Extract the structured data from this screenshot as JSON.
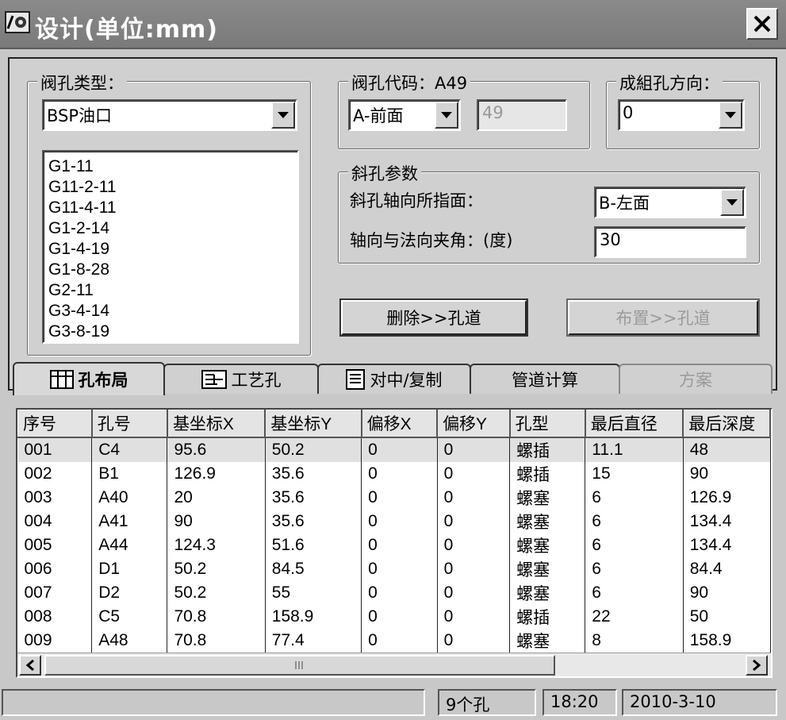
{
  "window": {
    "title": "设计(单位:mm)",
    "close_label": "X"
  },
  "hole_type": {
    "group_title": "阀孔类型：",
    "selected": "BSP油口",
    "list": [
      "G1-11",
      "G11-2-11",
      "G11-4-11",
      "G1-2-14",
      "G1-4-19",
      "G1-8-28",
      "G2-11",
      "G3-4-14",
      "G3-8-19"
    ]
  },
  "hole_code": {
    "group_title": "阀孔代码：A49",
    "face_selected": "A-前面",
    "code_value": "49"
  },
  "group_direction": {
    "group_title": "成組孔方向：",
    "selected": "0"
  },
  "oblique": {
    "group_title": "斜孔参数",
    "axis_face_label": "斜孔轴向所指面：",
    "axis_face_selected": "B-左面",
    "angle_label": "轴向与法向夹角：(度)",
    "angle_value": "30"
  },
  "buttons": {
    "delete": "删除>>孔道",
    "place": "布置>>孔道"
  },
  "tabs": [
    {
      "label": "孔布局",
      "icon": "layout-icon"
    },
    {
      "label": "工艺孔",
      "icon": "process-hole-icon"
    },
    {
      "label": "对中/复制",
      "icon": "document-icon"
    },
    {
      "label": "管道计算",
      "icon": ""
    },
    {
      "label": "方案",
      "icon": ""
    }
  ],
  "table": {
    "columns": [
      "序号",
      "孔号",
      "基坐标X",
      "基坐标Y",
      "偏移X",
      "偏移Y",
      "孔型",
      "最后直径",
      "最后深度"
    ],
    "rows": [
      [
        "001",
        "C4",
        "95.6",
        "50.2",
        "0",
        "0",
        "螺插",
        "11.1",
        "48"
      ],
      [
        "002",
        "B1",
        "126.9",
        "35.6",
        "0",
        "0",
        "螺插",
        "15",
        "90"
      ],
      [
        "003",
        "A40",
        "20",
        "35.6",
        "0",
        "0",
        "螺塞",
        "6",
        "126.9"
      ],
      [
        "004",
        "A41",
        "90",
        "35.6",
        "0",
        "0",
        "螺塞",
        "6",
        "134.4"
      ],
      [
        "005",
        "A44",
        "124.3",
        "51.6",
        "0",
        "0",
        "螺塞",
        "6",
        "134.4"
      ],
      [
        "006",
        "D1",
        "50.2",
        "84.5",
        "0",
        "0",
        "螺塞",
        "6",
        "84.4"
      ],
      [
        "007",
        "D2",
        "50.2",
        "55",
        "0",
        "0",
        "螺塞",
        "6",
        "90"
      ],
      [
        "008",
        "C5",
        "70.8",
        "158.9",
        "0",
        "0",
        "螺插",
        "22",
        "50"
      ],
      [
        "009",
        "A48",
        "70.8",
        "77.4",
        "0",
        "0",
        "螺塞",
        "8",
        "158.9"
      ]
    ]
  },
  "status": {
    "message": "",
    "hole_count": "9个孔",
    "time": "18:20",
    "date": "2010-3-10"
  }
}
